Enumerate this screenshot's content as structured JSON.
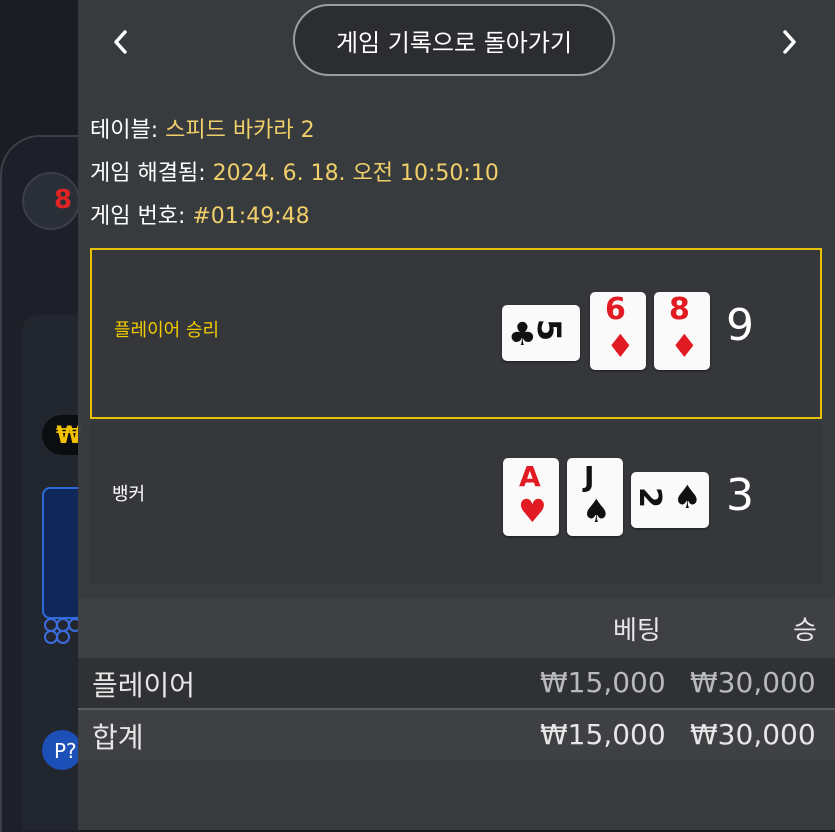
{
  "header": {
    "back_label": "게임 기록으로 돌아가기",
    "prev_icon": "chevron-left-icon",
    "next_icon": "chevron-right-icon"
  },
  "info": {
    "table_label": "테이블:",
    "table_value": "스피드 바카라 2",
    "resolved_label": "게임 해결됨:",
    "resolved_value": "2024. 6. 18. 오전 10:50:10",
    "game_no_label": "게임 번호:",
    "game_no_value": "#01:49:48"
  },
  "player": {
    "label": "플레이어 승리",
    "score": "9",
    "cards": [
      {
        "rank": "5",
        "suit": "♣"
      },
      {
        "rank": "6",
        "suit": "♦"
      },
      {
        "rank": "8",
        "suit": "♦"
      }
    ]
  },
  "banker": {
    "label": "뱅커",
    "score": "3",
    "cards": [
      {
        "rank": "A",
        "suit": "♥"
      },
      {
        "rank": "J",
        "suit": "♠"
      },
      {
        "rank": "2",
        "suit": "♠"
      }
    ]
  },
  "table": {
    "col_bet": "베팅",
    "col_win": "승",
    "rows": [
      {
        "name": "플레이어",
        "bet": "₩15,000",
        "win": "₩30,000"
      },
      {
        "name": "합계",
        "bet": "₩15,000",
        "win": "₩30,000"
      }
    ]
  },
  "background": {
    "chip_symbol": "₩",
    "p_badge": "P?"
  },
  "colors": {
    "accent": "#e8c100",
    "red_suit": "#e21b23",
    "panel": "#3a3c40"
  }
}
